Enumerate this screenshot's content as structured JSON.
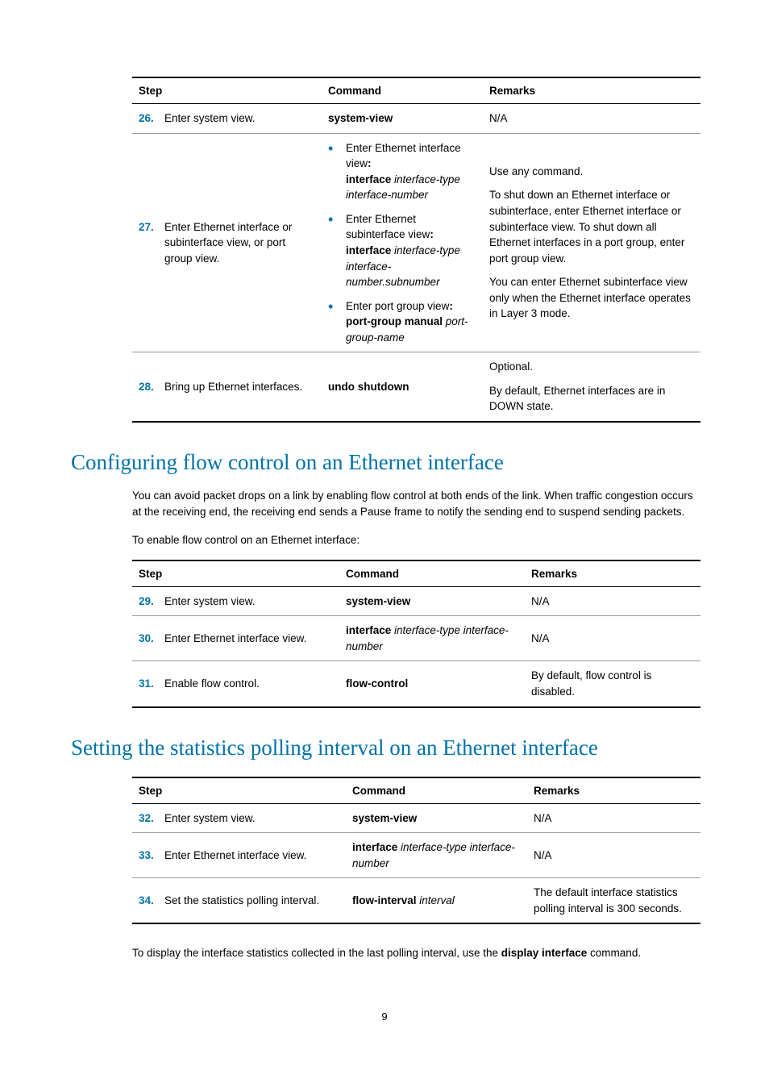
{
  "table1": {
    "headers": {
      "step": "Step",
      "command": "Command",
      "remarks": "Remarks"
    },
    "rows": [
      {
        "num": "26.",
        "desc": "Enter system view.",
        "cmd_bold": "system-view",
        "remarks": "N/A"
      },
      {
        "num": "27.",
        "desc": "Enter Ethernet interface or subinterface view, or port group view.",
        "cmd_bullets": [
          {
            "pre": "Enter Ethernet interface view",
            "cmd_b": "interface",
            "cmd_i1": "interface-type interface-number"
          },
          {
            "pre": "Enter Ethernet subinterface view",
            "cmd_b": "interface",
            "cmd_i1": "interface-type interface-number.subnumber"
          },
          {
            "pre": "Enter port group view",
            "cmd_b": "port-group manual",
            "cmd_i1": "port-group-name"
          }
        ],
        "remarks_multi": [
          "Use any command.",
          "To shut down an Ethernet interface or subinterface, enter Ethernet interface or subinterface view. To shut down all Ethernet interfaces in a port group, enter port group view.",
          "You can enter Ethernet subinterface view only when the Ethernet interface operates in Layer 3 mode."
        ]
      },
      {
        "num": "28.",
        "desc": "Bring up Ethernet interfaces.",
        "cmd_bold": "undo shutdown",
        "remarks_multi": [
          "Optional.",
          "By default, Ethernet interfaces are in DOWN state."
        ]
      }
    ]
  },
  "h2_flow": "Configuring flow control on an Ethernet interface",
  "flow_para1": "You can avoid packet drops on a link by enabling flow control at both ends of the link. When traffic congestion occurs at the receiving end, the receiving end sends a Pause frame to notify the sending end to suspend sending packets.",
  "flow_para2": "To enable flow control on an Ethernet interface:",
  "table2": {
    "headers": {
      "step": "Step",
      "command": "Command",
      "remarks": "Remarks"
    },
    "rows": [
      {
        "num": "29.",
        "desc": "Enter system view.",
        "cmd_bold": "system-view",
        "remarks": "N/A"
      },
      {
        "num": "30.",
        "desc": "Enter Ethernet interface view.",
        "cmd_b": "interface",
        "cmd_i": "interface-type interface-number",
        "remarks": "N/A"
      },
      {
        "num": "31.",
        "desc": "Enable flow control.",
        "cmd_bold": "flow-control",
        "remarks": "By default, flow control is disabled."
      }
    ]
  },
  "h2_stats": "Setting the statistics polling interval on an Ethernet interface",
  "table3": {
    "headers": {
      "step": "Step",
      "command": "Command",
      "remarks": "Remarks"
    },
    "rows": [
      {
        "num": "32.",
        "desc": "Enter system view.",
        "cmd_bold": "system-view",
        "remarks": "N/A"
      },
      {
        "num": "33.",
        "desc": "Enter Ethernet interface view.",
        "cmd_b": "interface",
        "cmd_i": "interface-type interface-number",
        "remarks": "N/A"
      },
      {
        "num": "34.",
        "desc": "Set the statistics polling interval.",
        "cmd_b": "flow-interval",
        "cmd_i": "interval",
        "remarks": "The default interface statistics polling interval is 300 seconds."
      }
    ]
  },
  "stats_para_pre": "To display the interface statistics collected in the last polling interval, use the ",
  "stats_para_bold": "display interface",
  "stats_para_post": " command.",
  "page_number": "9"
}
